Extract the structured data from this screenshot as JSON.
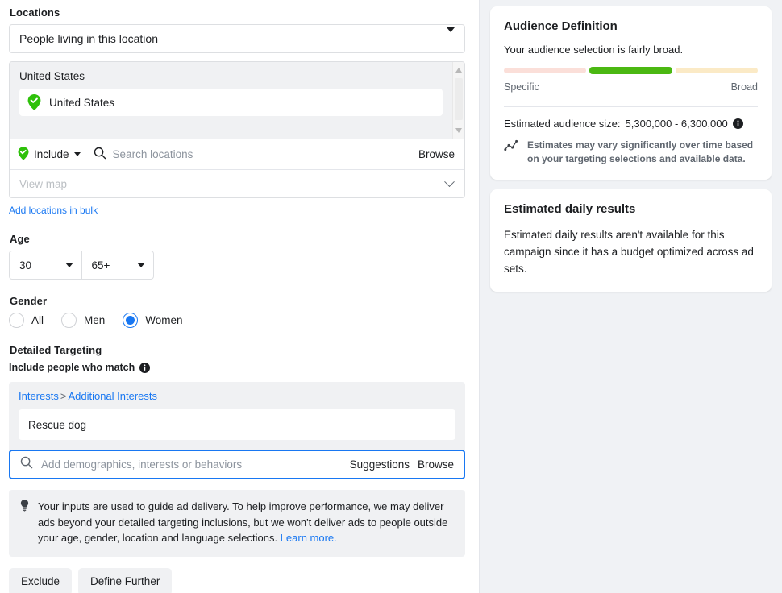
{
  "locations": {
    "heading": "Locations",
    "location_type_value": "People living in this location",
    "selected_group_title": "United States",
    "selected_items": [
      {
        "label": "United States",
        "icon": "location-pin-check-icon"
      }
    ],
    "include_label": "Include",
    "search_placeholder": "Search locations",
    "browse_label": "Browse",
    "view_map_label": "View map",
    "add_bulk_label": "Add locations in bulk"
  },
  "age": {
    "heading": "Age",
    "min_value": "30",
    "max_value": "65+"
  },
  "gender": {
    "heading": "Gender",
    "options": [
      {
        "label": "All",
        "selected": false
      },
      {
        "label": "Men",
        "selected": false
      },
      {
        "label": "Women",
        "selected": true
      }
    ]
  },
  "detailed_targeting": {
    "heading": "Detailed Targeting",
    "subheading": "Include people who match",
    "breadcrumb_root": "Interests",
    "breadcrumb_sep": ">",
    "breadcrumb_leaf": "Additional Interests",
    "selected_interests": [
      {
        "label": "Rescue dog"
      }
    ],
    "search_placeholder": "Add demographics, interests or behaviors",
    "suggestions_label": "Suggestions",
    "browse_label": "Browse",
    "notice_text": "Your inputs are used to guide ad delivery. To help improve performance, we may deliver ads beyond your detailed targeting inclusions, but we won't deliver ads to people outside your age, gender, location and language selections. ",
    "notice_link": "Learn more.",
    "exclude_label": "Exclude",
    "define_further_label": "Define Further"
  },
  "audience_definition": {
    "title": "Audience Definition",
    "summary": "Your audience selection is fairly broad.",
    "meter": {
      "segments": [
        {
          "name": "specific",
          "color": "#fbdfd9",
          "active": false
        },
        {
          "name": "balanced",
          "color": "#4bb812",
          "active": true
        },
        {
          "name": "broad",
          "color": "#fbeac6",
          "active": false
        }
      ],
      "left_label": "Specific",
      "right_label": "Broad"
    },
    "estimate_label": "Estimated audience size:",
    "estimate_value": "5,300,000 - 6,300,000",
    "disclaimer": "Estimates may vary significantly over time based on your targeting selections and available data."
  },
  "estimated_daily_results": {
    "title": "Estimated daily results",
    "body": "Estimated daily results aren't available for this campaign since it has a budget optimized across ad sets."
  },
  "colors": {
    "accent_blue": "#1877f2",
    "green": "#42b72a",
    "panel_bg": "#f0f2f5",
    "field_bg": "#f0f1f3"
  }
}
